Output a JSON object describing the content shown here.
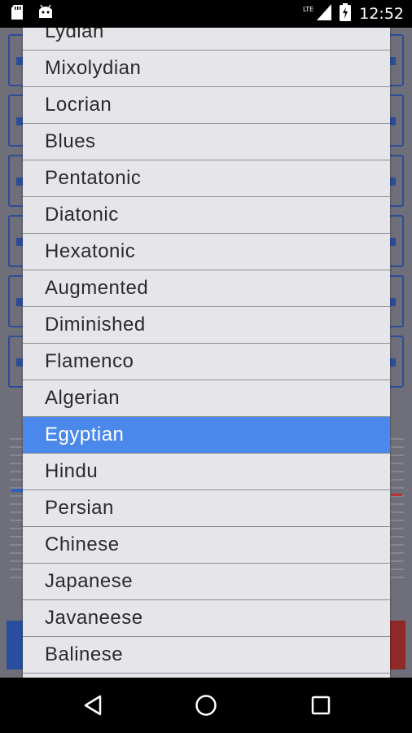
{
  "status_bar": {
    "time": "12:52",
    "network": "LTE",
    "icons": [
      "sd-card-icon",
      "android-debug-icon",
      "signal-icon",
      "battery-charging-icon"
    ]
  },
  "dropdown": {
    "items": [
      {
        "label": "Lydian"
      },
      {
        "label": "Mixolydian"
      },
      {
        "label": "Locrian"
      },
      {
        "label": "Blues"
      },
      {
        "label": "Pentatonic"
      },
      {
        "label": "Diatonic"
      },
      {
        "label": "Hexatonic"
      },
      {
        "label": "Augmented"
      },
      {
        "label": "Diminished"
      },
      {
        "label": "Flamenco"
      },
      {
        "label": "Algerian"
      },
      {
        "label": "Egyptian"
      },
      {
        "label": "Hindu"
      },
      {
        "label": "Persian"
      },
      {
        "label": "Chinese"
      },
      {
        "label": "Japanese"
      },
      {
        "label": "Javaneese"
      },
      {
        "label": "Balinese"
      }
    ],
    "selected": "Egyptian",
    "colors": {
      "background": "#e5e5ea",
      "selected": "#4a88ec",
      "divider": "#8d8d95"
    }
  },
  "nav_bar": {
    "buttons": [
      "back-icon",
      "home-icon",
      "recents-icon"
    ]
  }
}
